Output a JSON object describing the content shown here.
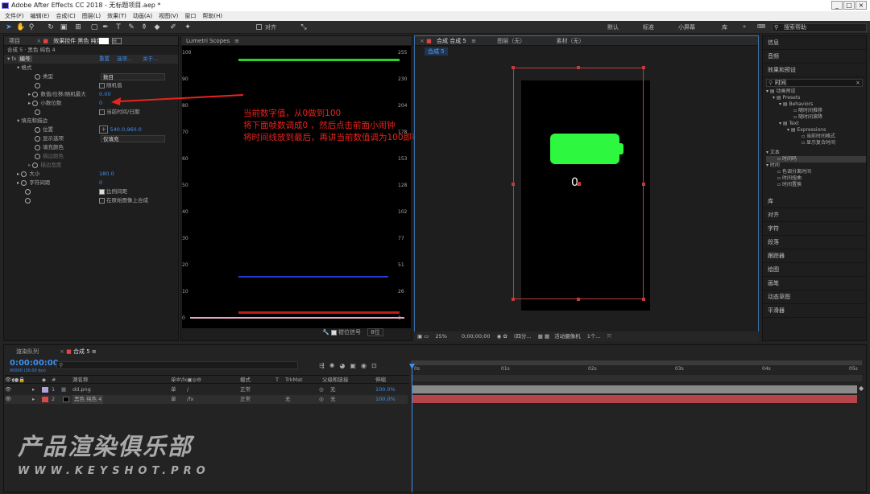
{
  "window": {
    "title": "Adobe After Effects CC 2018 - 无标题项目.aep *",
    "min": "_",
    "max": "□",
    "close": "×"
  },
  "menu": [
    "文件(F)",
    "编辑(E)",
    "合成(C)",
    "图层(L)",
    "效果(T)",
    "动画(A)",
    "视图(V)",
    "窗口",
    "帮助(H)"
  ],
  "toolbar": {
    "snap": "对齐",
    "workspaces": [
      "默认",
      "标准",
      "小屏幕",
      "库"
    ],
    "more": "»",
    "search_placeholder": "搜索帮助"
  },
  "left_panel": {
    "tab_project": "项目",
    "tab_effects": "效果控件 黑色 纯色 4",
    "breadcrumb": "合成 5 · 黑色 纯色 4",
    "fx_name": "编号",
    "fx_reset": "重置",
    "fx_options": "选项...",
    "fx_about": "关于...",
    "format_group": "格式",
    "type_label": "类型",
    "type_value": "数目",
    "random_label": "随机值",
    "value_label": "数值/位移/随机最大",
    "value_value": "0.00",
    "decimals_label": "小数位数",
    "decimals_value": "0",
    "curdate_label": "当前时间/日期",
    "fill_group": "填充和描边",
    "position_label": "位置",
    "position_value": "540.0,960.0",
    "display_label": "显示选项",
    "display_value": "仅填充",
    "fillcolor_label": "填充颜色",
    "strokecolor_label": "描边颜色",
    "strokewidth_label": "描边宽度",
    "size_label": "大小",
    "size_value": "180.0",
    "tracking_label": "字符间距",
    "tracking_value": "0",
    "proportional_label": "比例间距",
    "composite_label": "在原始图像上合成"
  },
  "scope": {
    "tab": "Lumetri Scopes",
    "left_ticks": [
      "100",
      "90",
      "80",
      "70",
      "60",
      "50",
      "40",
      "30",
      "20",
      "10",
      "0"
    ],
    "right_ticks": [
      "255",
      "230",
      "204",
      "178",
      "153",
      "128",
      "102",
      "77",
      "51",
      "26",
      "0"
    ],
    "clamp": "钳位信号",
    "bits": "8位"
  },
  "annotation": {
    "line1": "当前数字值，从0做到100",
    "line2": "将下面帧数调成0 ，然后点击前面小闹钟",
    "line3": "将时间线放到最后，再讲当前数值调为100即可"
  },
  "comp_viewer": {
    "tab": "合成 合成 5",
    "layer_tab": "图层（无）",
    "footage_tab": "素材（无）",
    "comp_chip": "合成 5",
    "digit": "0",
    "zoom": "25%",
    "timecode": "0;00;00;00",
    "quality": "(四分...",
    "camera": "活动摄像机",
    "views": "1个..."
  },
  "right_panel": {
    "info": "信息",
    "audio": "音频",
    "effects_presets": "效果和预设",
    "search_value": "时间",
    "tree": [
      "动画预设",
      "Presets",
      "Behaviors",
      "随时间推移",
      "随时间滚降",
      "Text",
      "Expressions",
      "当前时间格式",
      "显示复合时间"
    ],
    "text_group": "文本",
    "text_item": "时间码",
    "time_group": "时间",
    "time_items": [
      "色调分离时间",
      "时间扭曲",
      "时间置换"
    ],
    "sections": [
      "库",
      "对齐",
      "字符",
      "段落",
      "跟踪器",
      "绘图",
      "画笔",
      "动态草图",
      "平滑器"
    ]
  },
  "timeline": {
    "tab_render": "渲染队列",
    "tab_comp": "合成 5",
    "timecode": "0:00:00:00",
    "fps": "00000 (30.00 fps)",
    "col_source": "源名称",
    "col_switch": "单✲\\fx▣◎⚙",
    "col_mode": "模式",
    "col_t": "T",
    "col_trkmat": "TrkMat",
    "col_parent": "父级和链接",
    "col_stretch": "伸缩",
    "layers": [
      {
        "num": "1",
        "name": "dd.png",
        "switch": "单",
        "mode": "正常",
        "trkmat": "",
        "parent": "无",
        "stretch": "100.0%",
        "color": "#b3a3d8"
      },
      {
        "num": "2",
        "name": "黑色 纯色 4",
        "switch": "单",
        "mode": "正常",
        "trkmat": "无",
        "parent": "无",
        "stretch": "100.0%",
        "color": "#d84a4a"
      }
    ],
    "ruler": [
      "0s",
      "01s",
      "02s",
      "03s",
      "04s",
      "05s"
    ]
  },
  "watermark": {
    "title": "产品渲染俱乐部",
    "url": "WWW.KEYSHOT.PRO"
  },
  "colors": {
    "battery": "#2df73f",
    "accent": "#3d8ff2",
    "annotation": "#e8241e",
    "layer_red": "#b4464a",
    "layer_gray": "#898989"
  }
}
